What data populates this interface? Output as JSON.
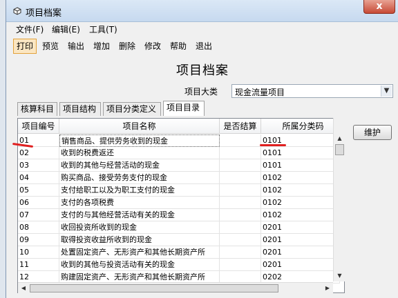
{
  "window": {
    "title": "项目档案",
    "close_label": "x"
  },
  "menu": [
    "文件(F)",
    "编辑(E)",
    "工具(T)"
  ],
  "toolbar": [
    "打印",
    "预览",
    "输出",
    "增加",
    "删除",
    "修改",
    "帮助",
    "退出"
  ],
  "heading": "项目档案",
  "category": {
    "label": "项目大类",
    "value": "现金流量项目"
  },
  "tabs": [
    "核算科目",
    "项目结构",
    "项目分类定义",
    "项目目录"
  ],
  "table": {
    "headers": [
      "项目编号",
      "项目名称",
      "是否结算",
      "所属分类码"
    ],
    "rows": [
      [
        "01",
        "销售商品、提供劳务收到的现金",
        "",
        "0101"
      ],
      [
        "02",
        "收到的税费返还",
        "",
        "0101"
      ],
      [
        "03",
        "收到的其他与经营活动的现金",
        "",
        "0101"
      ],
      [
        "04",
        "购买商品、接受劳务支付的现金",
        "",
        "0102"
      ],
      [
        "05",
        "支付给职工以及为职工支付的现金",
        "",
        "0102"
      ],
      [
        "06",
        "支付的各项税费",
        "",
        "0102"
      ],
      [
        "07",
        "支付的与其他经营活动有关的现金",
        "",
        "0102"
      ],
      [
        "08",
        "收回投资所收到的现金",
        "",
        "0201"
      ],
      [
        "09",
        "取得投资收益所收到的现金",
        "",
        "0201"
      ],
      [
        "10",
        "处置固定资产、无形资产和其他长期资产所",
        "",
        "0201"
      ],
      [
        "11",
        "收到的其他与投资活动有关的现金",
        "",
        "0201"
      ],
      [
        "12",
        "购建固定资产、无形资产和其他长期资产所",
        "",
        "0202"
      ]
    ]
  },
  "maintain_label": "维护",
  "colors": {
    "annotation": "#e01f1f",
    "active_button": "#fbe6c2"
  }
}
